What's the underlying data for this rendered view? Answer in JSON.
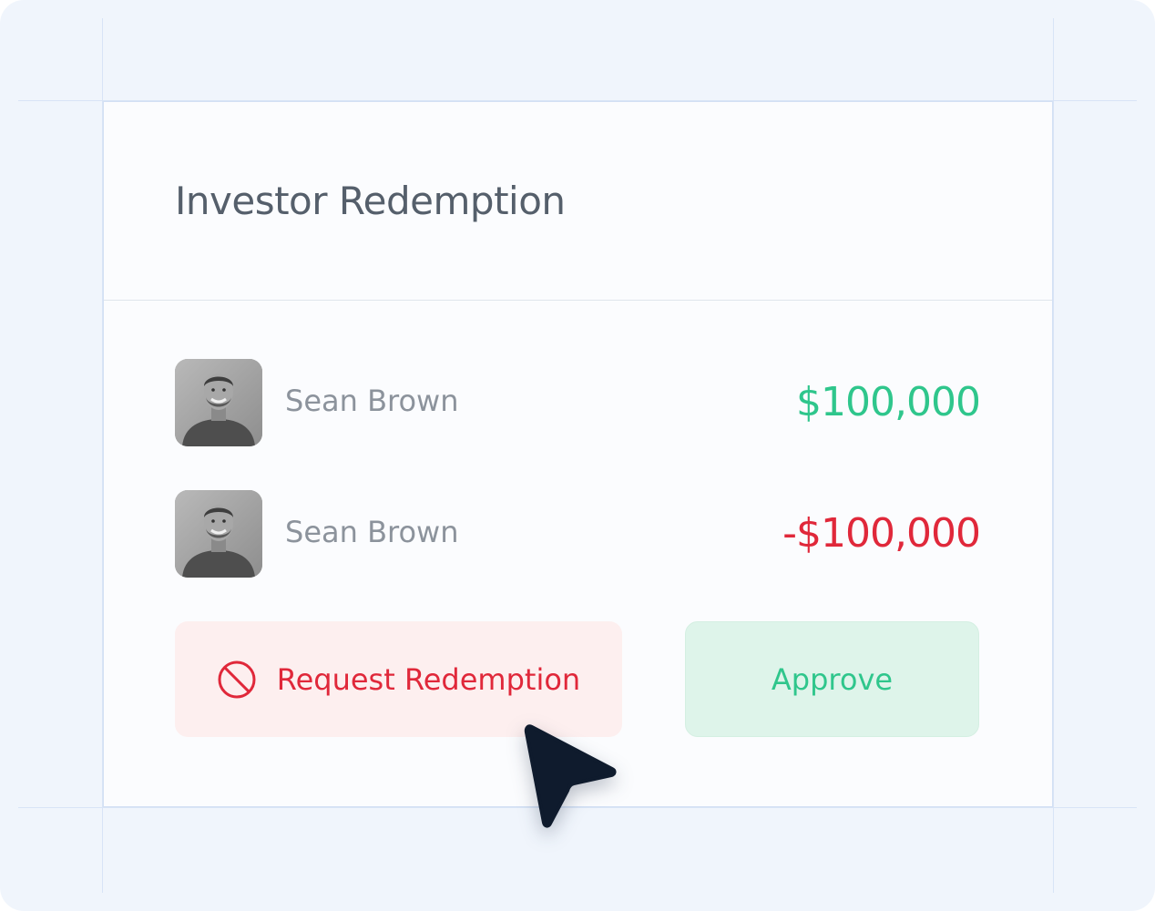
{
  "card": {
    "title": "Investor Redemption"
  },
  "transactions": [
    {
      "name": "Sean Brown",
      "amount": "$100,000",
      "status_color": "#2fc68c"
    },
    {
      "name": "Sean Brown",
      "amount": "-$100,000",
      "status_color": "#e0283a"
    }
  ],
  "actions": {
    "request_label": "Request Redemption",
    "request_icon": "ban-icon",
    "approve_label": "Approve"
  },
  "colors": {
    "positive": "#2fc68c",
    "negative": "#e0283a",
    "background": "#f0f5fc",
    "cursor": "#0f1b2d"
  }
}
